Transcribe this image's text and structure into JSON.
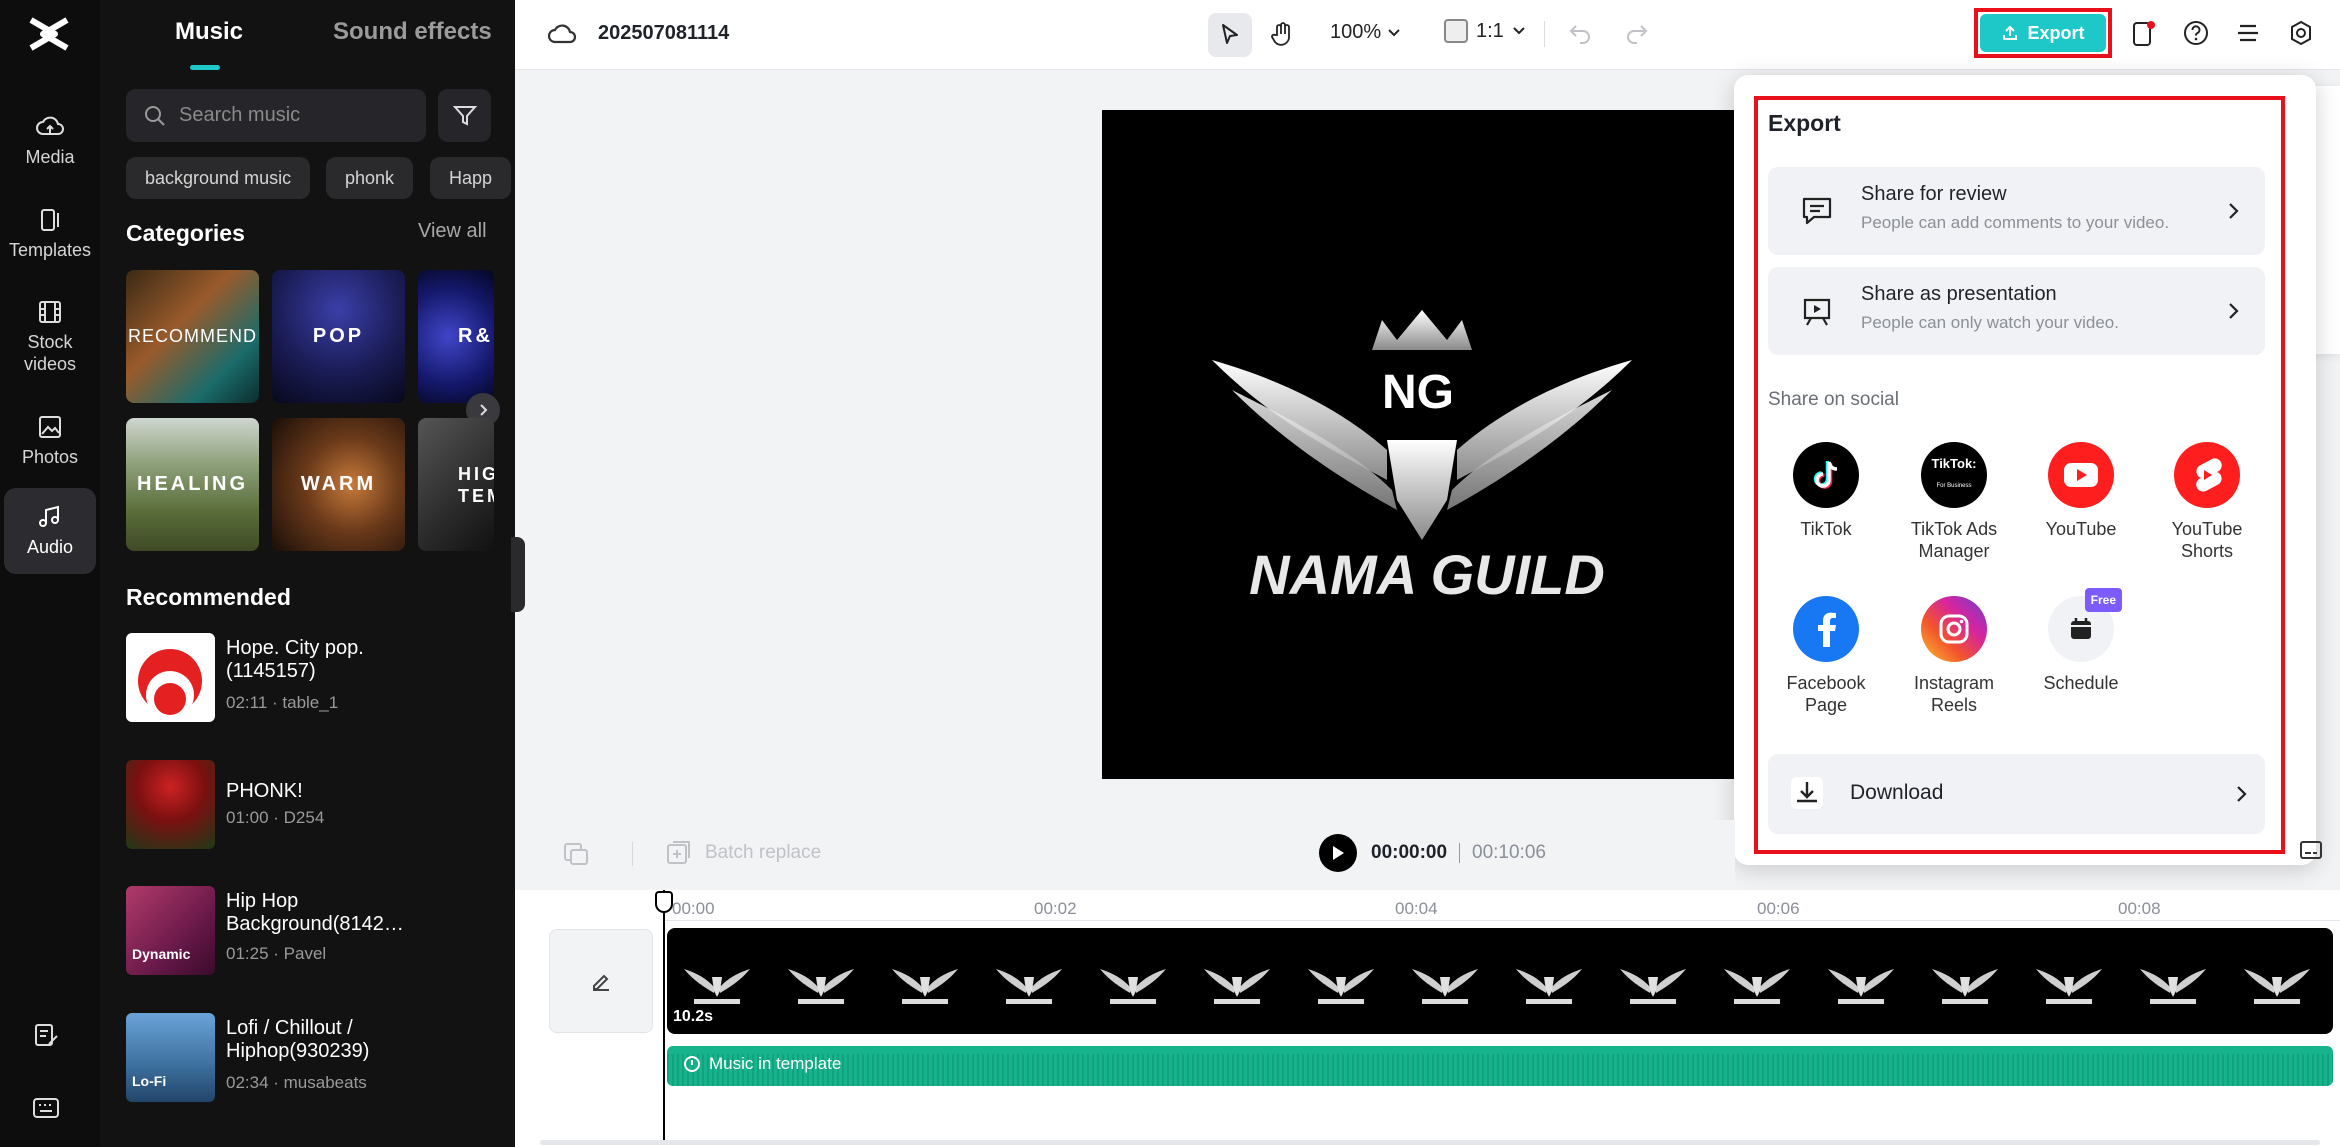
{
  "rail": {
    "items": [
      {
        "label": "Media",
        "icon": "cloud-upload-icon"
      },
      {
        "label": "Templates",
        "icon": "templates-icon"
      },
      {
        "label": "Stock videos",
        "icon": "film-icon"
      },
      {
        "label": "Photos",
        "icon": "photo-icon"
      },
      {
        "label": "Audio",
        "icon": "music-note-icon"
      }
    ]
  },
  "panel": {
    "tabs": [
      "Music",
      "Sound effects"
    ],
    "search_placeholder": "Search music",
    "chips": [
      "background music",
      "phonk",
      "Happ"
    ],
    "categories_title": "Categories",
    "view_all": "View all",
    "categories": [
      "RECOMMEND",
      "POP",
      "R&",
      "HEALING",
      "WARM",
      "HIG TEM"
    ],
    "recommended_title": "Recommended",
    "recommended": [
      {
        "title": "Hope. City pop. (1145157)",
        "sub": "02:11 · table_1"
      },
      {
        "title": "PHONK!",
        "sub": "01:00 · D254"
      },
      {
        "title": "Hip Hop Background(8142…",
        "sub": "01:25 · Pavel",
        "badge": "Dynamic"
      },
      {
        "title": "Lofi / Chillout / Hiphop(930239)",
        "sub": "02:34 · musabeats",
        "badge": "Lo-Fi"
      }
    ]
  },
  "topbar": {
    "project_name": "202507081114",
    "zoom": "100%",
    "ratio": "1:1",
    "export_label": "Export"
  },
  "canvas": {
    "logo_initials": "NG",
    "logo_text": "NAMA GUILD"
  },
  "export_popup": {
    "title": "Export",
    "share_review": {
      "title": "Share for review",
      "sub": "People can add comments to your video."
    },
    "share_presentation": {
      "title": "Share as presentation",
      "sub": "People can only watch your video."
    },
    "social_title": "Share on social",
    "socials": [
      {
        "label": "TikTok",
        "icon": "tiktok-icon"
      },
      {
        "label": "TikTok Ads Manager",
        "icon": "tiktok-ads-icon",
        "inner": "TikTok:",
        "inner_sub": "For Business"
      },
      {
        "label": "YouTube",
        "icon": "youtube-icon"
      },
      {
        "label": "YouTube Shorts",
        "icon": "youtube-shorts-icon"
      },
      {
        "label": "Facebook Page",
        "icon": "facebook-icon"
      },
      {
        "label": "Instagram Reels",
        "icon": "instagram-icon"
      },
      {
        "label": "Schedule",
        "icon": "calendar-icon",
        "badge": "Free"
      }
    ],
    "download": "Download",
    "colors": {
      "highlight": "#e8101b",
      "export_button": "#1ec8c8"
    }
  },
  "toolbar": {
    "batch_replace": "Batch replace",
    "current_time": "00:00:00",
    "total_time": "00:10:06"
  },
  "timeline": {
    "ticks": [
      "00:00",
      "00:02",
      "00:04",
      "00:06",
      "00:08"
    ],
    "clip_duration": "10.2s",
    "audio_label": "Music in template"
  }
}
